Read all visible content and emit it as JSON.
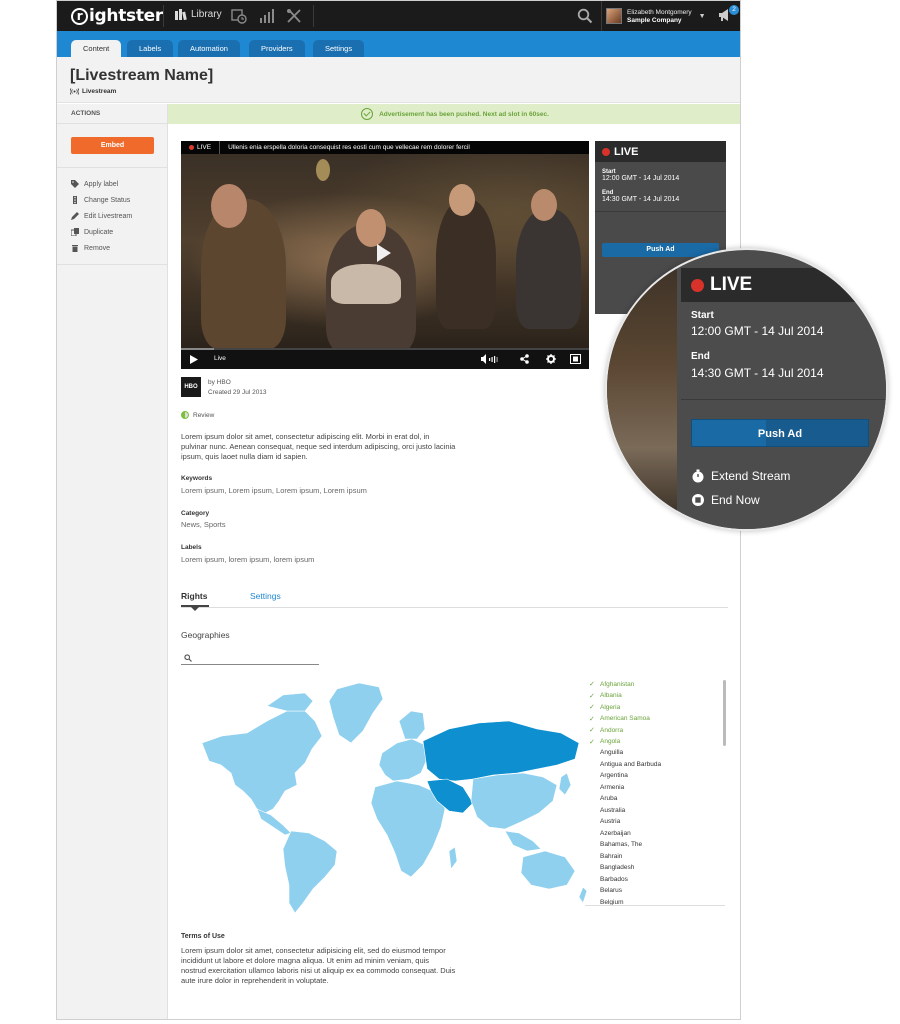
{
  "topnav": {
    "logo": "rightster",
    "logo_initial": "r",
    "logo_rest": "ightster",
    "library": "Library",
    "user_name": "Elizabeth Montgomery",
    "user_company": "Sample Company",
    "notifications": "2"
  },
  "tabs": [
    {
      "label": "Content",
      "active": true
    },
    {
      "label": "Labels",
      "active": false
    },
    {
      "label": "Automation",
      "active": false
    },
    {
      "label": "Providers",
      "active": false
    },
    {
      "label": "Settings",
      "active": false
    }
  ],
  "header": {
    "title": "[Livestream Name]",
    "subtitle": "Livestream"
  },
  "sidebar": {
    "heading": "ACTIONS",
    "embed": "Embed",
    "actions": [
      "Apply label",
      "Change Status",
      "Edit Livestream",
      "Duplicate",
      "Remove"
    ]
  },
  "notice": "Advertisement has been pushed. Next ad slot in 60sec.",
  "video": {
    "live_badge": "LIVE",
    "title": "Ullenis enia erspella doloria consequist res eosti cum que vellecae rem dolorer fercil",
    "status": "Live"
  },
  "live_panel": {
    "label": "LIVE",
    "start_label": "Start",
    "start_value": "12:00 GMT - 14 Jul 2014",
    "end_label": "End",
    "end_value": "14:30 GMT - 14 Jul 2014",
    "push_ad": "Push Ad",
    "extend": "Extend Stream",
    "end_now": "End Now"
  },
  "meta": {
    "provider_logo": "HBO",
    "by": "by HBO",
    "created": "Created 29 Jul 2013",
    "review": "Review",
    "description": "Lorem ipsum dolor sit amet, consectetur adipiscing elit. Morbi in erat dol, in pulvinar nunc. Aenean consequat, neque sed interdum adipiscing, orci justo lacinia ipsum, quis laoet nulla diam id sapien.",
    "keywords_label": "Keywords",
    "keywords": "Lorem ipsum, Lorem ipsum, Lorem ipsum, Lorem ipsum",
    "category_label": "Category",
    "category": "News, Sports",
    "labels_label": "Labels",
    "labels": "Lorem ipsum, lorem ipsum, lorem ipsum"
  },
  "rights": {
    "tab_rights": "Rights",
    "tab_settings": "Settings",
    "geographies": "Geographies",
    "search_placeholder": "",
    "countries": [
      {
        "name": "Afghanistan",
        "selected": true
      },
      {
        "name": "Albania",
        "selected": true
      },
      {
        "name": "Algeria",
        "selected": true
      },
      {
        "name": "American Samoa",
        "selected": true
      },
      {
        "name": "Andorra",
        "selected": true
      },
      {
        "name": "Angola",
        "selected": true
      },
      {
        "name": "Anguilla",
        "selected": false
      },
      {
        "name": "Antigua and Barbuda",
        "selected": false
      },
      {
        "name": "Argentina",
        "selected": false
      },
      {
        "name": "Armenia",
        "selected": false
      },
      {
        "name": "Aruba",
        "selected": false
      },
      {
        "name": "Australia",
        "selected": false
      },
      {
        "name": "Austria",
        "selected": false
      },
      {
        "name": "Azerbaijan",
        "selected": false
      },
      {
        "name": "Bahamas, The",
        "selected": false
      },
      {
        "name": "Bahrain",
        "selected": false
      },
      {
        "name": "Bangladesh",
        "selected": false
      },
      {
        "name": "Barbados",
        "selected": false
      },
      {
        "name": "Belarus",
        "selected": false
      },
      {
        "name": "Belgium",
        "selected": false
      }
    ],
    "terms_label": "Terms of Use",
    "terms": "Lorem ipsum dolor sit amet, consectetur adipisicing elit, sed do eiusmod tempor incididunt ut labore et dolore magna aliqua. Ut enim ad minim veniam, quis nostrud exercitation ullamco laboris nisi ut aliquip ex ea commodo consequat. Duis aute irure dolor in reprehenderit in voluptate."
  },
  "colors": {
    "accent_blue": "#1f88d2",
    "embed_orange": "#f06a2b",
    "live_red": "#d8322b",
    "success_green": "#6aa33a",
    "map_light": "#8fd0ef",
    "map_dark": "#0d8fd0"
  }
}
